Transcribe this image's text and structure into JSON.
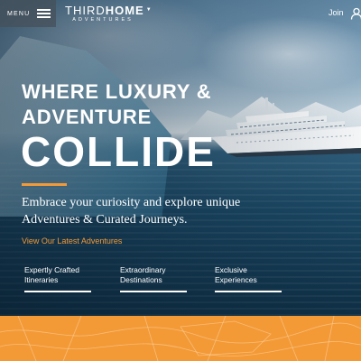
{
  "header": {
    "menu_label": "MENU",
    "logo_light": "THIRD",
    "logo_bold": "HOME",
    "logo_sub": "ADVENTURES",
    "join_label": "Join"
  },
  "hero": {
    "headline_line1": "WHERE LUXURY &",
    "headline_line2": "ADVENTURE",
    "headline_big": "COLLIDE",
    "tagline": "Embrace your curiosity and explore unique Adventures & Curated Journeys.",
    "cta_label": "View Our Latest Adventures"
  },
  "features": [
    {
      "label_line1": "Expertly Crafted",
      "label_line2": "Itineraries"
    },
    {
      "label_line1": "Extraordinary",
      "label_line2": "Destinations"
    },
    {
      "label_line1": "Exclusive",
      "label_line2": "Experiences"
    }
  ],
  "colors": {
    "accent": "#f39a37",
    "menu_bg": "#4a535c",
    "text_light": "#ffffff"
  },
  "icons": {
    "menu": "hamburger-icon",
    "user": "user-icon",
    "logo_caret": "caret-down-icon"
  }
}
